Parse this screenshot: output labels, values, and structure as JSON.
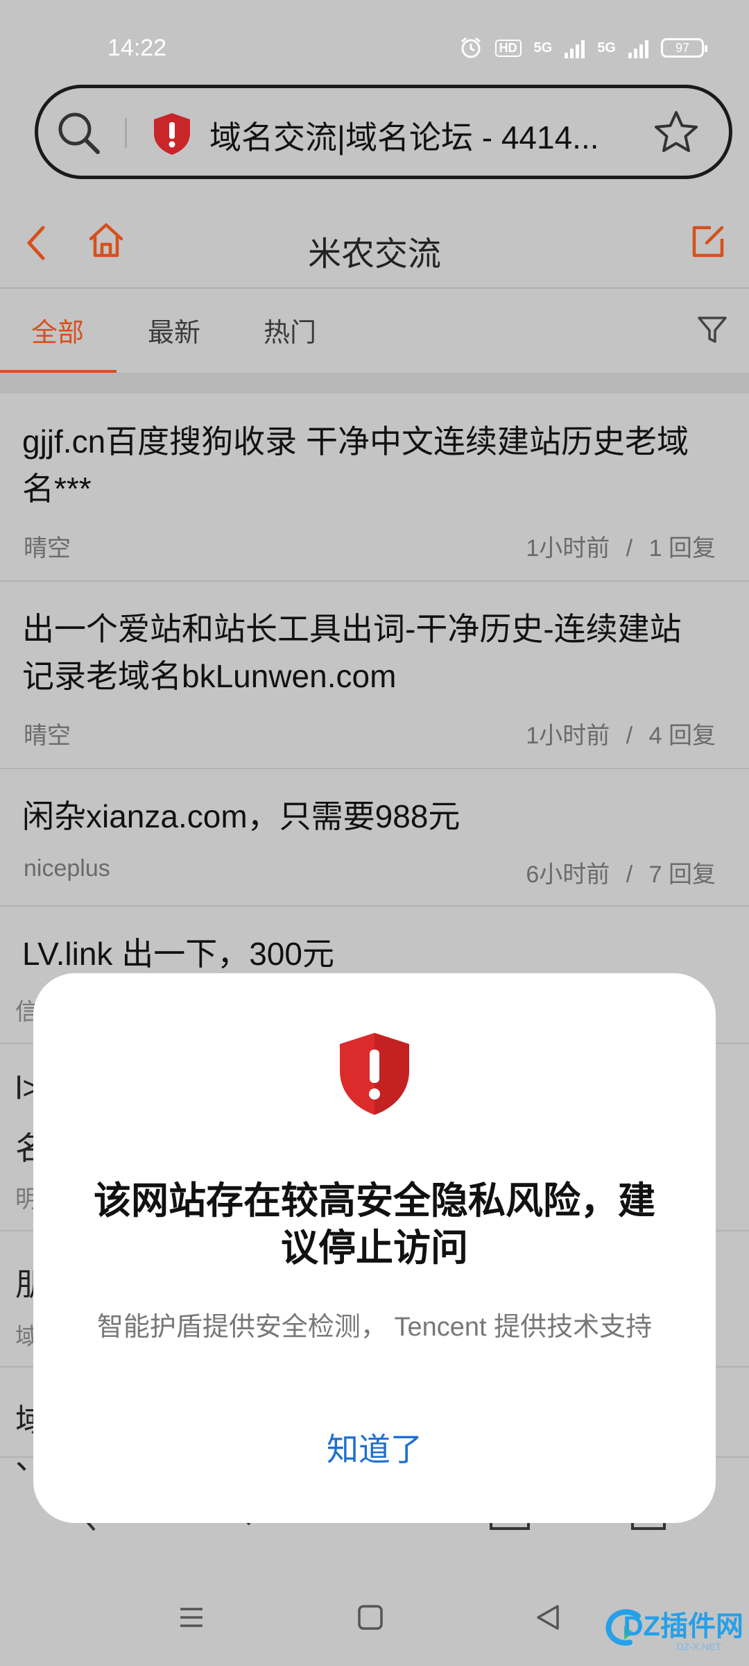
{
  "status_bar": {
    "time": "14:22",
    "hd_label": "HD",
    "net1": "5G",
    "net2": "5G",
    "battery": "97"
  },
  "address_bar": {
    "title": "域名交流|域名论坛 - 4414..."
  },
  "header": {
    "title": "米农交流"
  },
  "tabs": [
    {
      "label": "全部",
      "active": true
    },
    {
      "label": "最新",
      "active": false
    },
    {
      "label": "热门",
      "active": false
    }
  ],
  "posts": [
    {
      "title_line1": "gjjf.cn百度搜狗收录 干净中文连续建站历史老域",
      "title_line2": "名***",
      "author": "晴空",
      "time": "1小时前",
      "sep": "/",
      "replies": "1 回复"
    },
    {
      "title_line1": "出一个爱站和站长工具出词-干净历史-连续建站",
      "title_line2": "记录老域名bkLunwen.com",
      "author": "晴空",
      "time": "1小时前",
      "sep": "/",
      "replies": "4 回复"
    },
    {
      "title_line1": "闲杂xianza.com，只需要988元",
      "title_line2": "",
      "author": "niceplus",
      "time": "6小时前",
      "sep": "/",
      "replies": "7 回复"
    },
    {
      "title_line1": "LV.link 出一下，300元",
      "title_line2": "",
      "author": "",
      "time": "",
      "sep": "",
      "replies": ""
    }
  ],
  "partial_text": {
    "p1": "信",
    "p2": "l>",
    "p3": "名",
    "p4": "明",
    "p5": "朋",
    "p6": "域",
    "p7": "域",
    "p8": "、"
  },
  "dialog": {
    "title": "该网站存在较高安全隐私风险，建议停止访问",
    "subtitle": "智能护盾提供安全检测， Tencent 提供技术支持",
    "button": "知道了"
  },
  "watermark": {
    "text": "DZ插件网",
    "sub": "DZ-X.NET"
  },
  "colors": {
    "accent": "#d6501c",
    "danger": "#e02b2b",
    "link": "#1d6fd0"
  }
}
